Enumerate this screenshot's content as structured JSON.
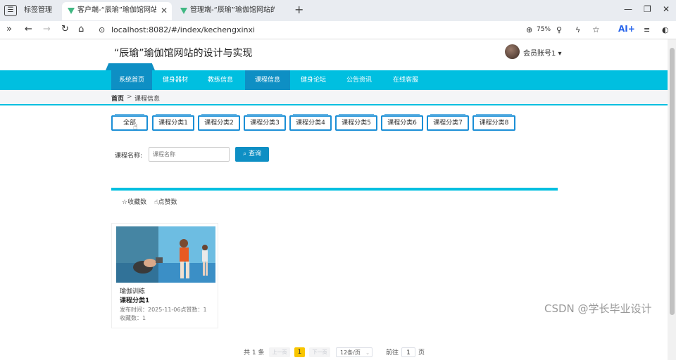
{
  "browser": {
    "tab_group_label": "标签管理",
    "tabs": [
      {
        "label": "客户端-“辰瑜”瑜伽馆网站的",
        "active": true
      },
      {
        "label": "管理端-“辰瑜”瑜伽馆网站的设",
        "active": false
      }
    ],
    "url": "localhost:8082/#/index/kechengxinxi",
    "zoom": "75%",
    "ai_label": "AI+"
  },
  "header": {
    "site_title": "“辰瑜”瑜伽馆网站的设计与实现",
    "user_label": "会员账号1 ▾"
  },
  "nav": {
    "items": [
      "系统首页",
      "健身器材",
      "教练信息",
      "课程信息",
      "健身论坛",
      "公告资讯",
      "在线客服"
    ],
    "active_index": 3,
    "accent_color": "#00bfe0",
    "active_color": "#0e8fc4"
  },
  "breadcrumb": {
    "home": "首页",
    "sep": ">",
    "current": "课程信息"
  },
  "categories": [
    "全部",
    "课程分类1",
    "课程分类2",
    "课程分类3",
    "课程分类4",
    "课程分类5",
    "课程分类6",
    "课程分类7",
    "课程分类8"
  ],
  "search": {
    "label": "课程名称:",
    "placeholder": "课程名称",
    "button_label": "查询"
  },
  "sort": {
    "favorites": "收藏数",
    "likes": "点赞数"
  },
  "card": {
    "name": "瑜伽训练",
    "category": "课程分类1",
    "meta_line1": "发布时间：2025-11-06点赞数：1",
    "meta_line2": "收藏数：1"
  },
  "pagination": {
    "total": "共 1 条",
    "prev": "上一页",
    "current_page": "1",
    "next": "下一页",
    "page_size": "12条/页",
    "goto_label": "前往",
    "goto_value": "1",
    "page_suffix": "页"
  },
  "watermark": "CSDN @学长毕业设计"
}
